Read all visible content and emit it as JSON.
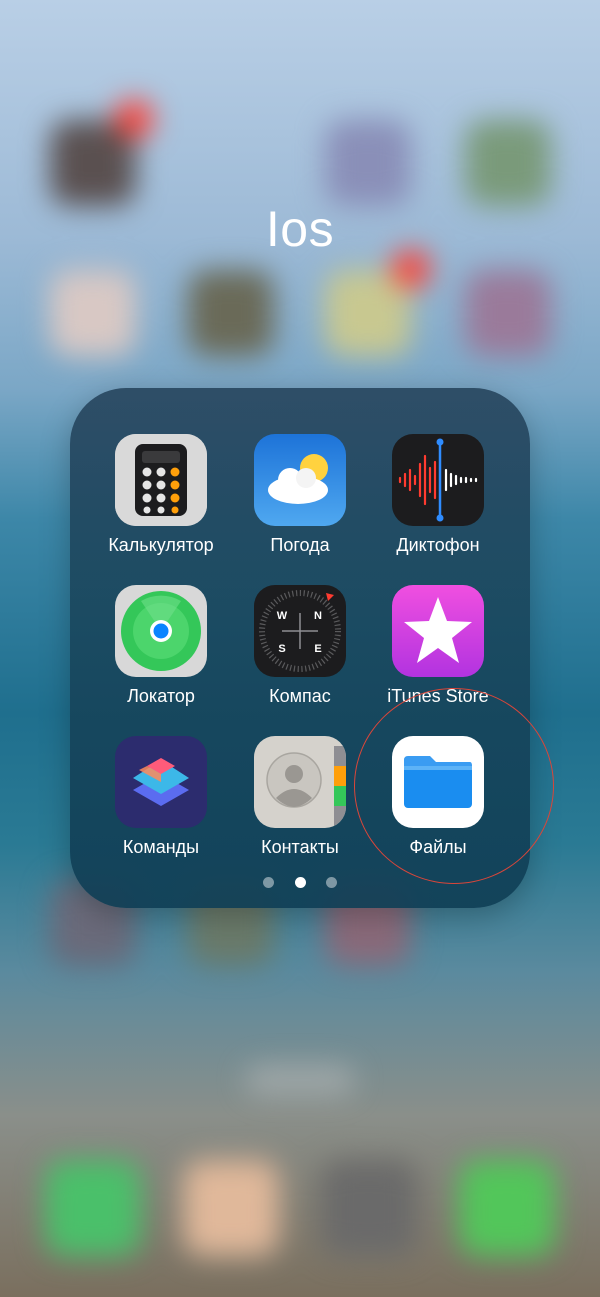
{
  "folder": {
    "title": "Ios",
    "apps": [
      {
        "label": "Калькулятор",
        "icon": "calculator-icon"
      },
      {
        "label": "Погода",
        "icon": "weather-icon"
      },
      {
        "label": "Диктофон",
        "icon": "voice-memos-icon"
      },
      {
        "label": "Локатор",
        "icon": "find-my-icon"
      },
      {
        "label": "Компас",
        "icon": "compass-icon"
      },
      {
        "label": "iTunes Store",
        "icon": "itunes-store-icon"
      },
      {
        "label": "Команды",
        "icon": "shortcuts-icon"
      },
      {
        "label": "Контакты",
        "icon": "contacts-icon"
      },
      {
        "label": "Файлы",
        "icon": "files-icon"
      }
    ],
    "pages": {
      "count": 3,
      "current": 2
    }
  },
  "compass": {
    "north": "N",
    "east": "E",
    "south": "S",
    "west": "W"
  },
  "colors": {
    "highlight": "#d9463a",
    "label": "#ffffff"
  }
}
